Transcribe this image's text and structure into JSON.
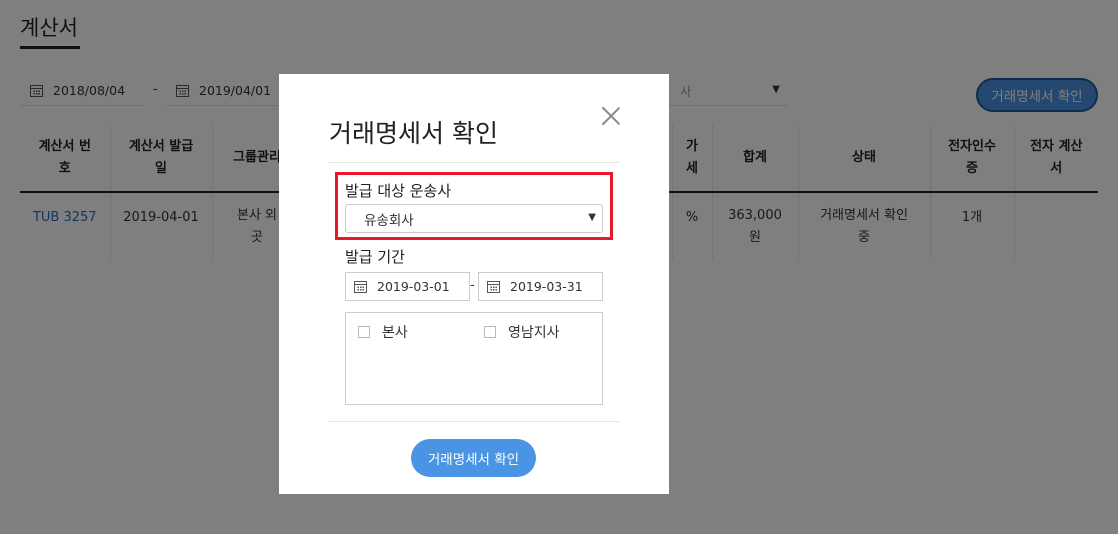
{
  "page": {
    "title": "계산서",
    "filters": {
      "start_date": "2018/08/04",
      "separator": "-",
      "end_date": "2019/04/01",
      "select_partial": "사",
      "top_button": "거래명세서 확인"
    },
    "table": {
      "headers": [
        [
          "계산서 번",
          "호"
        ],
        [
          "계산서 발급",
          "일"
        ],
        [
          "그룹관리",
          ""
        ],
        [
          "",
          ""
        ],
        [
          "가",
          "세"
        ],
        [
          "합계",
          ""
        ],
        [
          "상태",
          ""
        ],
        [
          "전자인수",
          "증"
        ],
        [
          "전자 계산",
          "서"
        ]
      ],
      "rows": [
        {
          "cells": [
            [
              "TUB 3257",
              ""
            ],
            [
              "2019-04-01",
              ""
            ],
            [
              "본사 외",
              "곳"
            ],
            [
              "",
              ""
            ],
            [
              "%",
              ""
            ],
            [
              "363,000",
              "원"
            ],
            [
              "거래명세서 확인",
              "중"
            ],
            [
              "1개",
              ""
            ],
            [
              "",
              ""
            ]
          ]
        }
      ]
    }
  },
  "modal": {
    "title": "거래명세서 확인",
    "carrier_label": "발급 대상 운송사",
    "carrier_value": "유송회사",
    "period_label": "발급 기간",
    "period_start": "2019-03-01",
    "period_separator": "-",
    "period_end": "2019-03-31",
    "branches": [
      {
        "label": "본사",
        "checked": false
      },
      {
        "label": "영남지사",
        "checked": false
      }
    ],
    "confirm_button": "거래명세서 확인"
  },
  "colors": {
    "accent": "#4a90e2",
    "highlight": "#e8192c",
    "link": "#2a6fc0"
  },
  "icons": {
    "calendar": "calendar-icon",
    "close": "close-icon",
    "dropdown": "dropdown-arrow-icon",
    "checkbox": "checkbox-icon"
  }
}
